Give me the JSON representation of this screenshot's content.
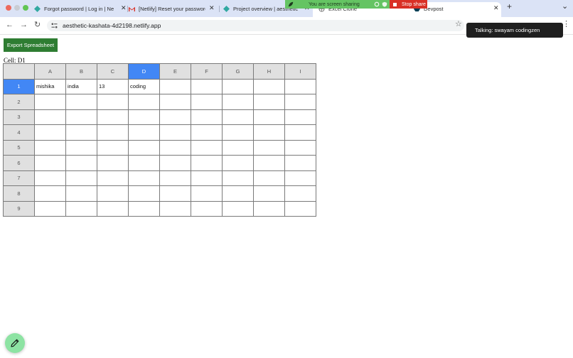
{
  "browser": {
    "tabs": [
      {
        "title": "Forgot password | Log in | Ne",
        "icon": "netlify-icon"
      },
      {
        "title": "[Netlify] Reset your password",
        "icon": "gmail-icon"
      },
      {
        "title": "Project overview | aesthetic",
        "icon": "netlify-icon"
      },
      {
        "title": "Excel Clone",
        "icon": "globe-icon"
      },
      {
        "title": "Devpost",
        "icon": "devpost-icon"
      }
    ],
    "url": "aesthetic-kashata-4d2198.netlify.app",
    "new_tab": "+",
    "menu_glyph": "⌄"
  },
  "screen_share": {
    "message": "You are screen sharing",
    "stop_label": "Stop share"
  },
  "toast": "Talking: swayam codingzen",
  "sheet": {
    "export_label": "Export Spreadsheet",
    "cell_ref": "Cell: D1",
    "columns": [
      "A",
      "B",
      "C",
      "D",
      "E",
      "F",
      "G",
      "H",
      "I"
    ],
    "selected_column": "D",
    "selected_row": "1",
    "rows": [
      {
        "num": "1",
        "cells": [
          "mishika",
          "india",
          "13",
          "coding",
          "",
          "",
          "",
          "",
          ""
        ]
      },
      {
        "num": "2",
        "cells": [
          "",
          "",
          "",
          "",
          "",
          "",
          "",
          "",
          ""
        ]
      },
      {
        "num": "3",
        "cells": [
          "",
          "",
          "",
          "",
          "",
          "",
          "",
          "",
          ""
        ]
      },
      {
        "num": "4",
        "cells": [
          "",
          "",
          "",
          "",
          "",
          "",
          "",
          "",
          ""
        ]
      },
      {
        "num": "5",
        "cells": [
          "",
          "",
          "",
          "",
          "",
          "",
          "",
          "",
          ""
        ]
      },
      {
        "num": "6",
        "cells": [
          "",
          "",
          "",
          "",
          "",
          "",
          "",
          "",
          ""
        ]
      },
      {
        "num": "7",
        "cells": [
          "",
          "",
          "",
          "",
          "",
          "",
          "",
          "",
          ""
        ]
      },
      {
        "num": "8",
        "cells": [
          "",
          "",
          "",
          "",
          "",
          "",
          "",
          "",
          ""
        ]
      },
      {
        "num": "9",
        "cells": [
          "",
          "",
          "",
          "",
          "",
          "",
          "",
          "",
          ""
        ]
      }
    ]
  },
  "colors": {
    "selected_header": "#4287f5",
    "export_button": "#2e7d32",
    "fab": "#8de3a3"
  }
}
